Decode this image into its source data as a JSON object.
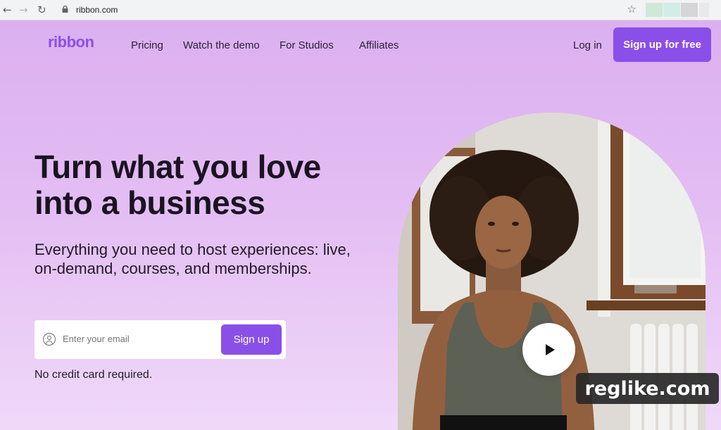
{
  "browser": {
    "url": "ribbon.com",
    "back_icon": "back-arrow-icon",
    "forward_icon": "forward-arrow-icon",
    "reload_icon": "reload-icon",
    "star_icon": "star-icon"
  },
  "header": {
    "logo": "ribbon",
    "nav": [
      "Pricing",
      "Watch the demo",
      "For Studios",
      "Affiliates"
    ],
    "login": "Log in",
    "signup": "Sign up for free"
  },
  "hero": {
    "headline_line1": "Turn what you love",
    "headline_line2": "into a business",
    "subhead": "Everything you need to host experiences: live, on-demand, courses, and memberships.",
    "email_placeholder": "Enter your email",
    "signup_button": "Sign up",
    "note": "No credit card required."
  },
  "watermark": "reglike.com",
  "colors": {
    "accent": "#8a4fe8",
    "background_top": "#dcb0ef",
    "background_bottom": "#f0d9f8"
  }
}
